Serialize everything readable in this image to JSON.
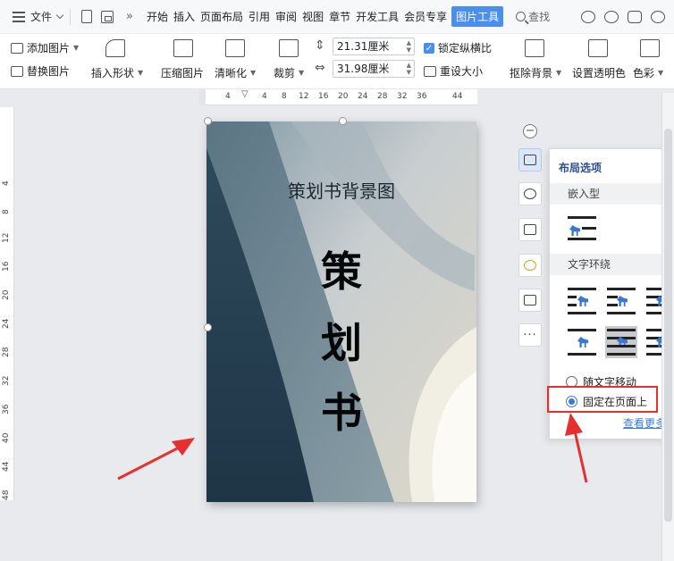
{
  "menubar": {
    "file_label": "文件",
    "tabs": [
      "开始",
      "插入",
      "页面布局",
      "引用",
      "审阅",
      "视图",
      "章节",
      "开发工具",
      "会员专享",
      "图片工具"
    ],
    "active_tab": "图片工具",
    "search_label": "查找"
  },
  "ribbon": {
    "add_picture": "添加图片",
    "replace_picture": "替换图片",
    "insert_shape": "插入形状",
    "compress_picture": "压缩图片",
    "sharpen": "清晰化",
    "crop": "裁剪",
    "height_value": "21.31厘米",
    "width_value": "31.98厘米",
    "lock_aspect": "锁定纵横比",
    "reset_size": "重设大小",
    "remove_background": "抠除背景",
    "set_transparent": "设置透明色",
    "color": "色彩"
  },
  "hruler": {
    "numbers": [
      "4",
      "4",
      "8",
      "12",
      "16",
      "20",
      "24",
      "28",
      "32",
      "36",
      "44"
    ]
  },
  "vruler": {
    "numbers": [
      "4",
      "8",
      "12",
      "16",
      "20",
      "24",
      "28",
      "32",
      "36",
      "40",
      "44",
      "48"
    ]
  },
  "page": {
    "title": "策划书背景图",
    "chars": [
      "策",
      "划",
      "书"
    ]
  },
  "layout_panel": {
    "title": "布局选项",
    "inline_header": "嵌入型",
    "wrap_header": "文字环绕",
    "move_with_text": "随文字移动",
    "fix_on_page": "固定在页面上",
    "fix_on_page_selected": true,
    "see_more": "查看更多..."
  },
  "colors": {
    "accent": "#4a8ef0",
    "highlight_box": "#e63030",
    "arrow": "#e63030"
  }
}
